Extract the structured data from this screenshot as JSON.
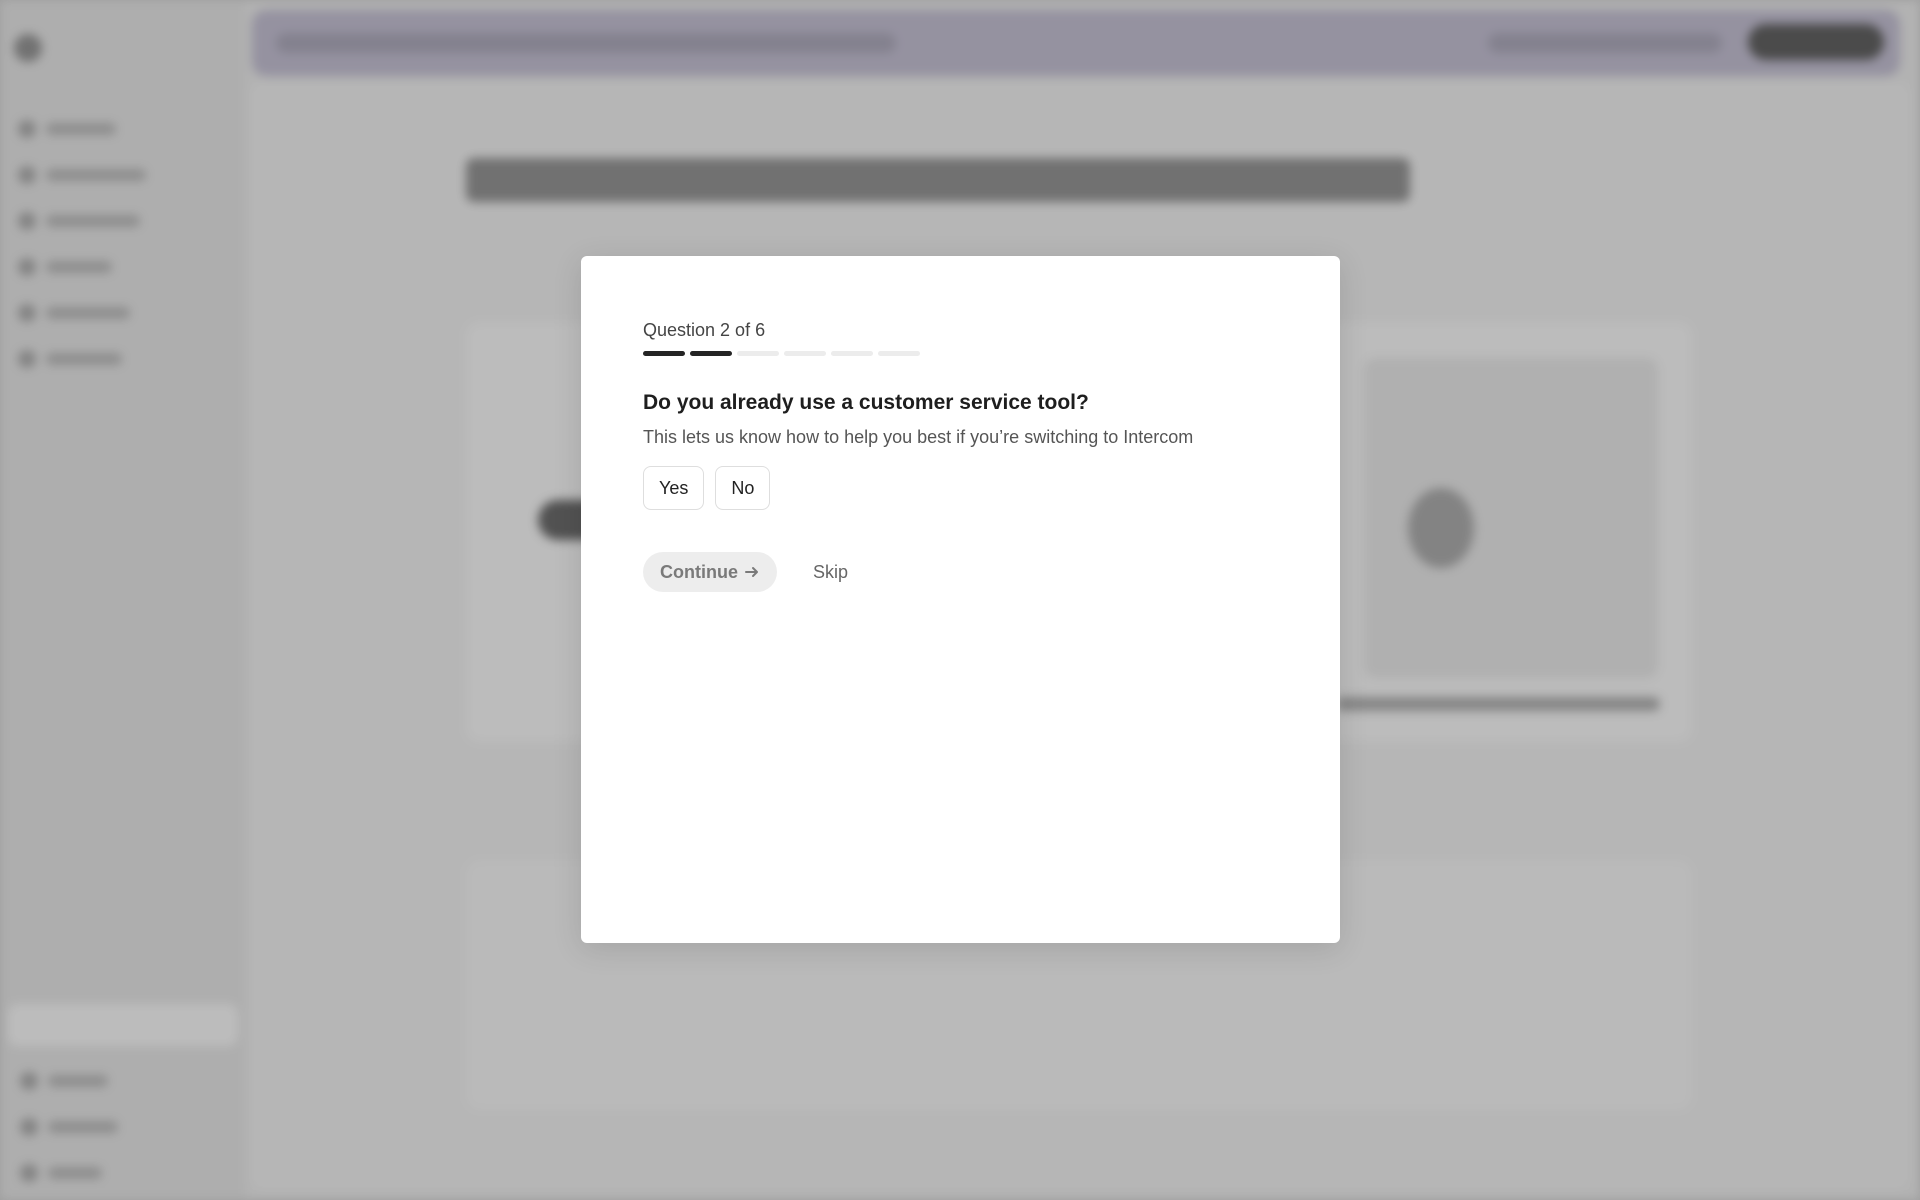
{
  "modal": {
    "counter": "Question 2 of 6",
    "progress": {
      "current": 2,
      "total": 6
    },
    "question": "Do you already use a customer service tool?",
    "hint": "This lets us know how to help you best if you’re switching to Intercom",
    "options": [
      "Yes",
      "No"
    ],
    "continue_label": "Continue",
    "skip_label": "Skip"
  },
  "colors": {
    "progress_done": "#242424",
    "progress_todo": "#ececec",
    "continue_bg": "#ededed",
    "topbar_accent": "#a7a2b9"
  },
  "icons": {
    "continue": "arrow-right-icon"
  }
}
